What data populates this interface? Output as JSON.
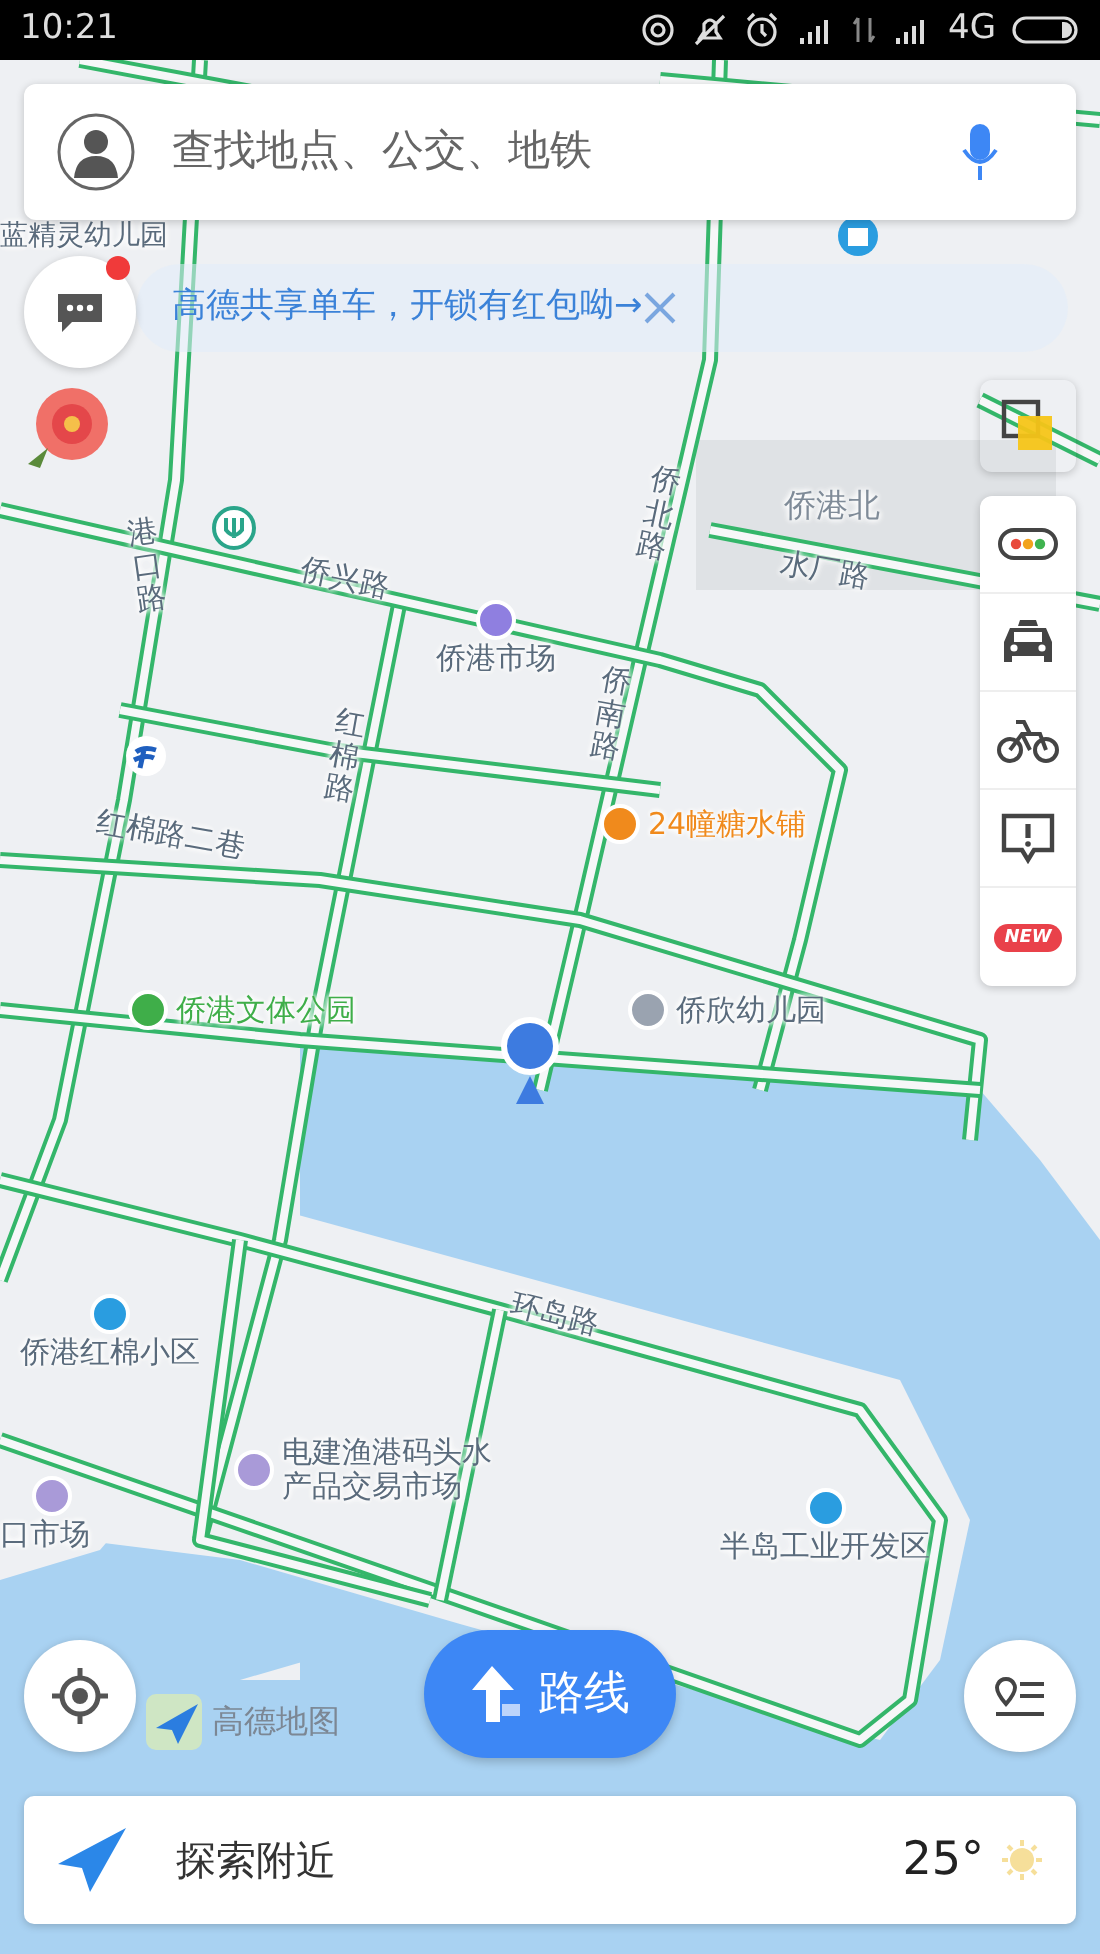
{
  "status_bar": {
    "time": "10:21",
    "network": "4G"
  },
  "search": {
    "placeholder": "查找地点、公交、地铁"
  },
  "banner": {
    "text": "高德共享单车，开锁有红包呦→",
    "unread": true
  },
  "map": {
    "labels": [
      {
        "kind": "place",
        "text": "蓝精灵幼儿园"
      },
      {
        "kind": "road-v",
        "text": "港口路"
      },
      {
        "kind": "road",
        "text": "侨兴路"
      },
      {
        "kind": "poi",
        "text": "侨港市场",
        "color": "#8f7fe0"
      },
      {
        "kind": "road-v",
        "text": "侨北路"
      },
      {
        "kind": "faded",
        "text": "侨港北"
      },
      {
        "kind": "road",
        "text": "水厂路"
      },
      {
        "kind": "road-v",
        "text": "侨南路"
      },
      {
        "kind": "road-v",
        "text": "红棉路"
      },
      {
        "kind": "road",
        "text": "红棉路二巷"
      },
      {
        "kind": "poi",
        "text": "24幢糖水铺",
        "color": "#f08a1c"
      },
      {
        "kind": "poi",
        "text": "侨港文体公园",
        "color": "#3fae49"
      },
      {
        "kind": "poi",
        "text": "侨欣幼儿园",
        "color": "#9aa3b0"
      },
      {
        "kind": "poi",
        "text": "侨港红棉小区",
        "color": "#2a9de0"
      },
      {
        "kind": "road",
        "text": "环岛路"
      },
      {
        "kind": "poi",
        "text": "电建渔港码头水产品交易市场",
        "color": "#a99ad8"
      },
      {
        "kind": "poi",
        "text": "口市场",
        "color": "#a99ad8"
      },
      {
        "kind": "poi",
        "text": "半岛工业开发区",
        "color": "#2a9de0"
      }
    ]
  },
  "toolbar": {
    "items": [
      {
        "kind": "traffic"
      },
      {
        "kind": "taxi"
      },
      {
        "kind": "bike"
      },
      {
        "kind": "report"
      },
      {
        "kind": "new",
        "text": "NEW"
      }
    ]
  },
  "logo": "高德地图",
  "route_button": "路线",
  "bottom_bar": {
    "label": "探索附近",
    "temperature": "25°"
  }
}
